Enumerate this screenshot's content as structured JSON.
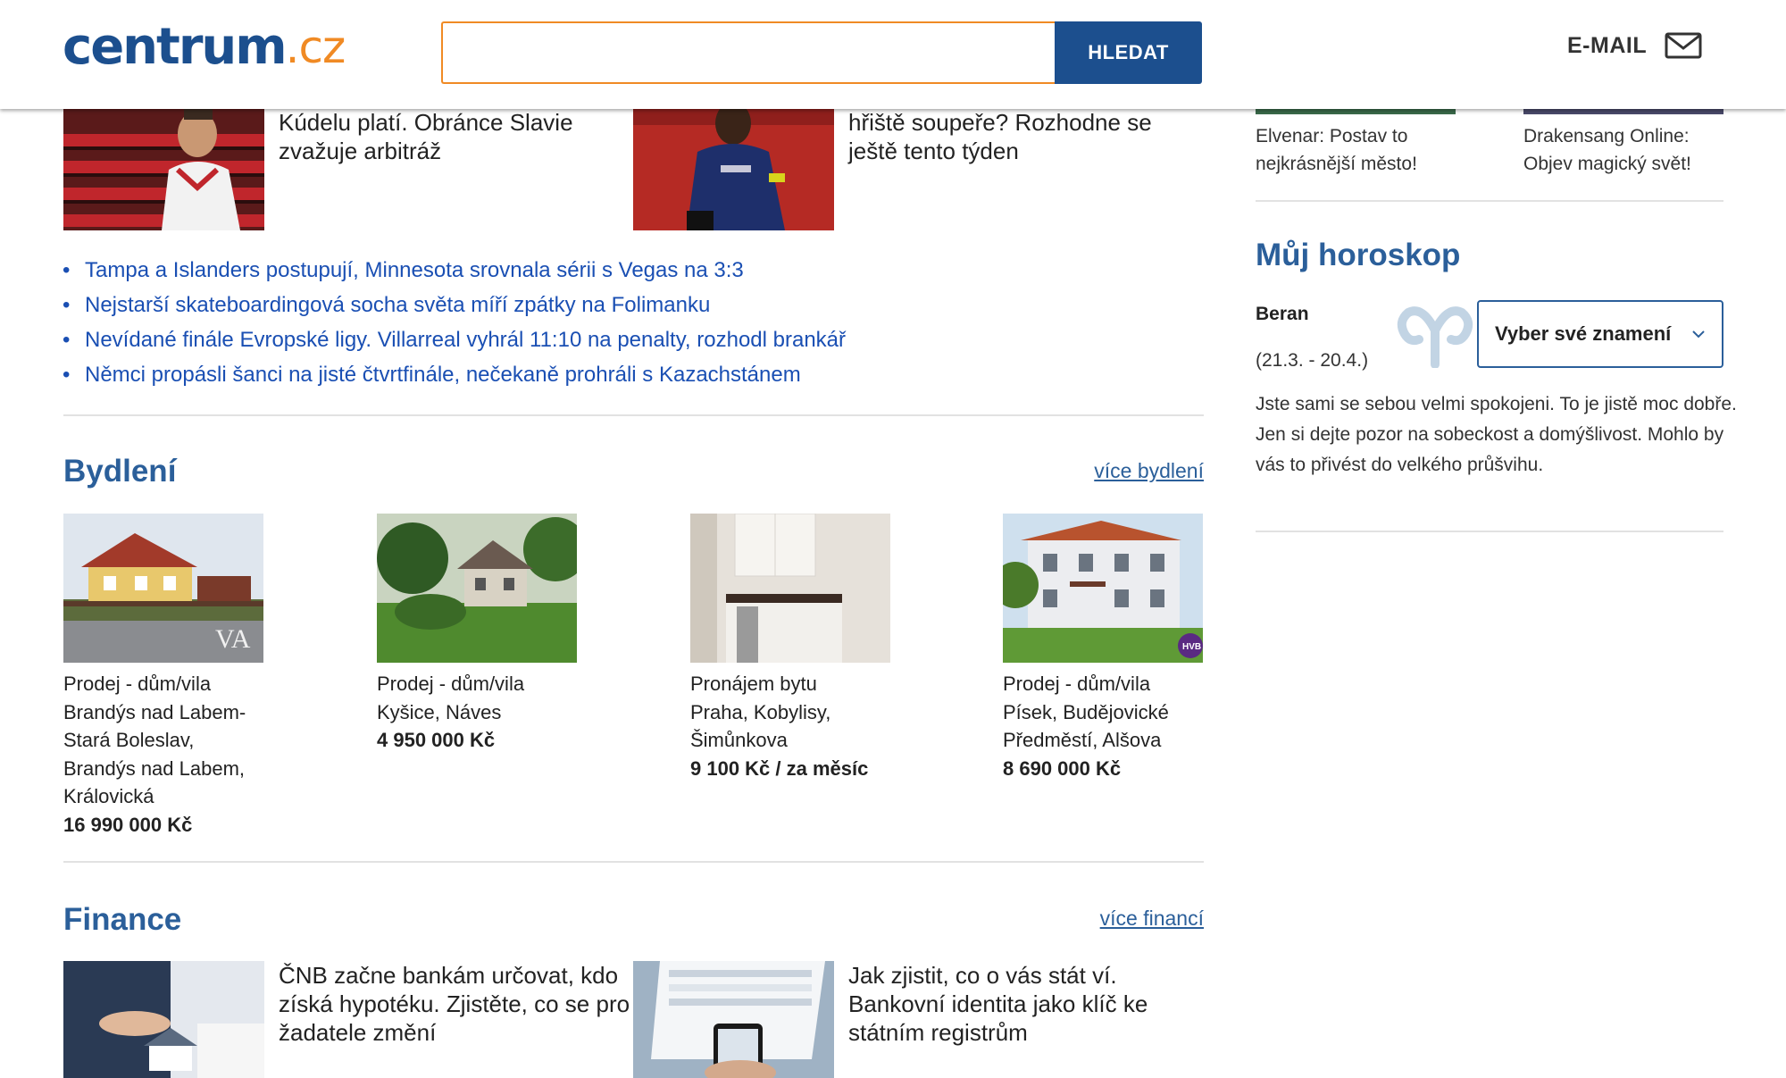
{
  "header": {
    "logo_brand": "centrum",
    "logo_tld": ".cz",
    "search_placeholder": "",
    "search_button": "HLEDAT",
    "email_label": "E-MAIL"
  },
  "sport": {
    "articles": [
      {
        "title": "Kúdelu platí. Obránce Slavie zvažuje arbitráž"
      },
      {
        "title": "hřiště soupeře? Rozhodne se ještě tento týden"
      }
    ],
    "links": [
      "Tampa a Islanders postupují, Minnesota srovnala sérii s Vegas na 3:3",
      "Nejstarší skateboardingová socha světa míří zpátky na Folimanku",
      "Nevídané finále Evropské ligy. Villarreal vyhrál 11:10 na penalty, rozhodl brankář",
      "Němci propásli šanci na jisté čtvrtfinále, nečekaně prohráli s Kazachstánem"
    ]
  },
  "bydleni": {
    "heading": "Bydlení",
    "more": "více bydlení",
    "cards": [
      {
        "type": "Prodej - dům/vila",
        "place": "Brandýs nad Labem-Stará Boleslav, Brandýs nad Labem, Královická",
        "price": "16 990 000 Kč"
      },
      {
        "type": "Prodej - dům/vila",
        "place": "Kyšice, Náves",
        "price": "4 950 000 Kč"
      },
      {
        "type": "Pronájem bytu",
        "place": "Praha, Kobylisy, Šimůnkova",
        "price": "9 100 Kč / za měsíc"
      },
      {
        "type": "Prodej - dům/vila",
        "place": "Písek, Budějovické Předměstí, Alšova",
        "price": "8 690 000 Kč"
      }
    ]
  },
  "finance": {
    "heading": "Finance",
    "more": "více financí",
    "articles": [
      {
        "title": "ČNB začne bankám určovat, kdo získá hypotéku. Zjistěte, co se pro žadatele změní"
      },
      {
        "title": "Jak zjistit, co o vás stát ví. Bankovní identita jako klíč ke státním registrům"
      }
    ]
  },
  "sidebar": {
    "games": [
      {
        "caption": "Elvenar: Postav to nejkrásnější město!"
      },
      {
        "caption": "Drakensang Online: Objev magický svět!"
      }
    ],
    "horoscope": {
      "heading": "Můj horoskop",
      "sign": "Beran",
      "dates": "(21.3. - 20.4.)",
      "select_label": "Vyber své znamení",
      "text": "Jste sami se sebou velmi spokojeni. To je jistě moc dobře. Jen si dejte pozor na sobeckost a domýšlivost. Mohlo by vás to přivést do velkého průšvihu."
    }
  },
  "colors": {
    "brand_blue": "#1c4f8e",
    "accent_orange": "#f08a24",
    "heading_blue": "#2b5f9a",
    "link_blue": "#1a4fb3"
  }
}
